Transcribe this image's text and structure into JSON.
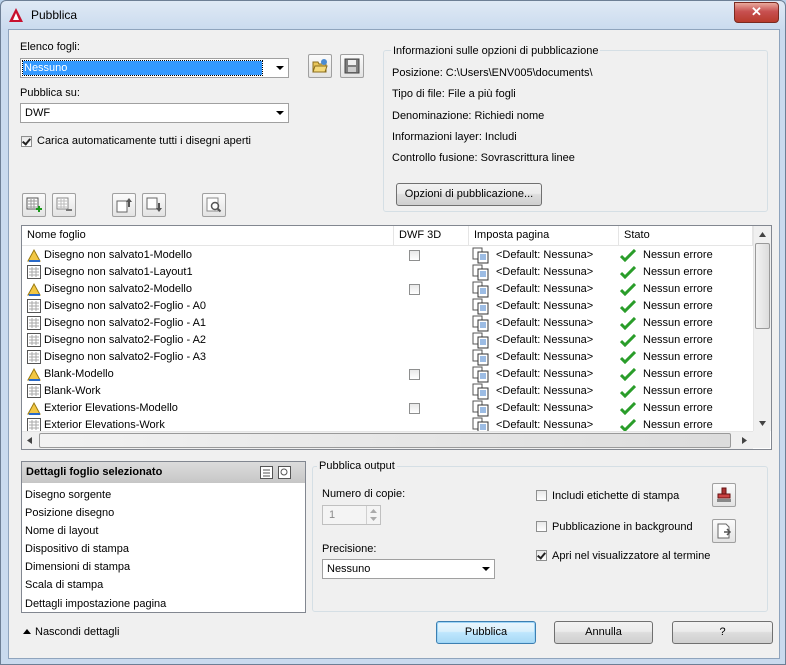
{
  "window": {
    "title": "Pubblica",
    "close_label": "✕"
  },
  "sheet_list": {
    "label": "Elenco fogli:",
    "value": "Nessuno"
  },
  "publish_to": {
    "label": "Pubblica su:",
    "value": "DWF"
  },
  "auto_load": {
    "label": "Carica automaticamente tutti i disegni aperti",
    "checked": true
  },
  "publish_info": {
    "title": "Informazioni sulle opzioni di pubblicazione",
    "lines": [
      "Posizione:  C:\\Users\\ENV005\\documents\\",
      "Tipo di file: File a più fogli",
      "Denominazione: Richiedi nome",
      "Informazioni layer: Includi",
      "Controllo fusione: Sovrascrittura linee"
    ],
    "options_button": "Opzioni di pubblicazione..."
  },
  "table": {
    "columns": [
      "Nome foglio",
      "DWF 3D",
      "Imposta pagina",
      "Stato"
    ],
    "rows": [
      {
        "name": "Disegno non salvato1-Modello",
        "type": "model",
        "dwf3d": true,
        "page_setup": "<Default: Nessuna>",
        "status": "Nessun errore"
      },
      {
        "name": "Disegno non salvato1-Layout1",
        "type": "layout",
        "dwf3d": false,
        "page_setup": "<Default: Nessuna>",
        "status": "Nessun errore"
      },
      {
        "name": "Disegno non salvato2-Modello",
        "type": "model",
        "dwf3d": true,
        "page_setup": "<Default: Nessuna>",
        "status": "Nessun errore"
      },
      {
        "name": "Disegno non salvato2-Foglio - A0",
        "type": "layout",
        "dwf3d": false,
        "page_setup": "<Default: Nessuna>",
        "status": "Nessun errore"
      },
      {
        "name": "Disegno non salvato2-Foglio - A1",
        "type": "layout",
        "dwf3d": false,
        "page_setup": "<Default: Nessuna>",
        "status": "Nessun errore"
      },
      {
        "name": "Disegno non salvato2-Foglio - A2",
        "type": "layout",
        "dwf3d": false,
        "page_setup": "<Default: Nessuna>",
        "status": "Nessun errore"
      },
      {
        "name": "Disegno non salvato2-Foglio - A3",
        "type": "layout",
        "dwf3d": false,
        "page_setup": "<Default: Nessuna>",
        "status": "Nessun errore"
      },
      {
        "name": "Blank-Modello",
        "type": "model",
        "dwf3d": true,
        "page_setup": "<Default: Nessuna>",
        "status": "Nessun errore"
      },
      {
        "name": "Blank-Work",
        "type": "layout",
        "dwf3d": false,
        "page_setup": "<Default: Nessuna>",
        "status": "Nessun errore"
      },
      {
        "name": "Exterior Elevations-Modello",
        "type": "model",
        "dwf3d": true,
        "page_setup": "<Default: Nessuna>",
        "status": "Nessun errore"
      },
      {
        "name": "Exterior Elevations-Work",
        "type": "layout",
        "dwf3d": false,
        "page_setup": "<Default: Nessuna>",
        "status": "Nessun errore"
      }
    ]
  },
  "details": {
    "title": "Dettagli foglio selezionato",
    "items": [
      "Disegno sorgente",
      "Posizione disegno",
      "Nome di layout",
      "Dispositivo di stampa",
      "Dimensioni di stampa",
      "Scala di stampa",
      "Dettagli impostazione pagina"
    ]
  },
  "output": {
    "title": "Pubblica output",
    "copies_label": "Numero di copie:",
    "copies_value": "1",
    "precision_label": "Precisione:",
    "precision_value": "Nessuno",
    "include_stamps": {
      "label": "Includi etichette di stampa",
      "checked": false
    },
    "background": {
      "label": "Pubblicazione in background",
      "checked": false
    },
    "open_viewer": {
      "label": "Apri nel visualizzatore al termine",
      "checked": true
    }
  },
  "footer": {
    "hide_details": "Nascondi dettagli",
    "publish": "Pubblica",
    "cancel": "Annulla",
    "help": "?"
  },
  "colors": {
    "accent": "#3399ff",
    "ok_green": "#2a9d2a",
    "title_icon": "#c8102e"
  }
}
